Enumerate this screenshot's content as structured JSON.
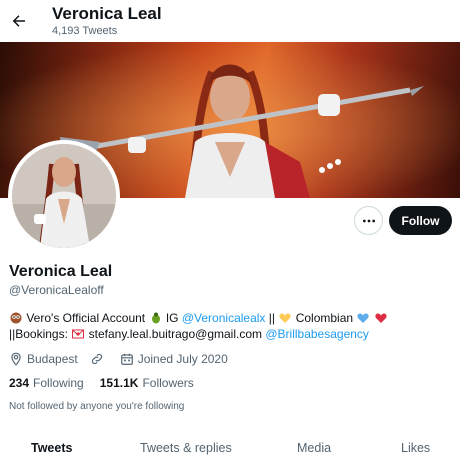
{
  "header": {
    "title": "Veronica Leal",
    "tweet_count": "4,193 Tweets",
    "back_icon": "arrow-left-icon"
  },
  "profile": {
    "name": "Veronica Leal",
    "handle": "@VeronicaLealoff",
    "more_icon": "more-horizontal-icon",
    "follow_label": "Follow"
  },
  "bio": {
    "part1": "Vero's Official Account",
    "part2": "IG",
    "ig_link": "@Veronicalealx",
    "part3": "||",
    "part4": "Colombian",
    "part5": "",
    "part6": "||Bookings:",
    "email": "stefany.leal.buitrago@gmail.com",
    "agency_link": "@Brillbabesagency"
  },
  "meta": {
    "location": "Budapest",
    "website": "",
    "joined": "Joined July 2020"
  },
  "stats": {
    "following_count": "234",
    "following_label": "Following",
    "followers_count": "151.1K",
    "followers_label": "Followers"
  },
  "not_followed": "Not followed by anyone you're following",
  "tabs": [
    {
      "label": "Tweets",
      "active": true
    },
    {
      "label": "Tweets & replies",
      "active": false
    },
    {
      "label": "Media",
      "active": false
    },
    {
      "label": "Likes",
      "active": false
    }
  ],
  "colors": {
    "accent": "#1d9bf0",
    "text": "#0f1419",
    "secondary": "#536471",
    "button_dark": "#0f1419"
  }
}
